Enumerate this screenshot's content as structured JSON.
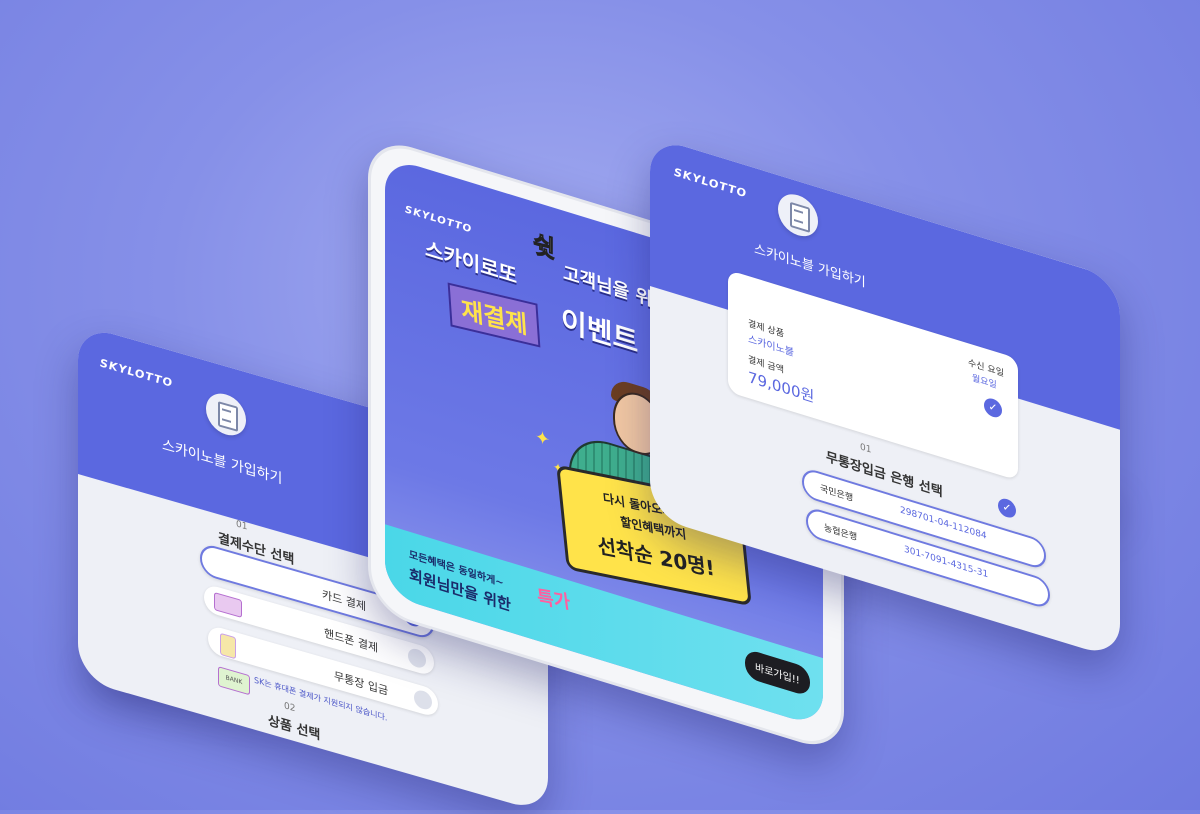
{
  "brand": {
    "logo_text": "SKYLOTTO",
    "logo_sub": "SKYLOTTO"
  },
  "left_phone": {
    "title": "스카이노블 가입하기",
    "step1_num": "01",
    "step1_label": "결제수단 선택",
    "options": [
      {
        "label": "카드 결제",
        "selected": true,
        "icon": "card-icon"
      },
      {
        "label": "핸드폰 결제",
        "selected": false,
        "icon": "phone-icon"
      },
      {
        "label": "무통장 입금",
        "selected": false,
        "icon": "bank-icon"
      }
    ],
    "bank_icon_text": "BANK",
    "notice": "SK는 휴대폰 결제가 지원되지 않습니다.",
    "step2_num": "02",
    "step2_label": "상품 선택"
  },
  "center_phone": {
    "headline_1": "스카이로또",
    "headline_accent": "쉿",
    "headline_2": "고객님을 위한",
    "tag": "재결제",
    "event": "이벤트",
    "sign_line1": "다시 돌아오지 않을",
    "sign_line2": "할인혜택까지",
    "sign_line3": "선착순 20명!",
    "ad_line1": "모든혜택은 동일하게~",
    "ad_line2": "회원님만을 위한",
    "ad_accent": "특가",
    "join_button": "바로가입!!"
  },
  "right_phone": {
    "title": "스카이노블 가입하기",
    "cycle_label": "수신 요일",
    "cycle_value": "월요일",
    "product_label": "결제 상품",
    "product_value": "스카이노블",
    "amount_label": "결제 금액",
    "amount_value": "79,000원",
    "step_num": "01",
    "step_label": "무통장입금 은행 선택",
    "banks": [
      {
        "name": "국민은행",
        "account": "298701-04-112084"
      },
      {
        "name": "농협은행",
        "account": "301-7091-4315-31"
      }
    ]
  },
  "colors": {
    "accent": "#5b68e0",
    "background": "#8690e8",
    "sign": "#ffe34a",
    "ad": "#4ad7e8"
  }
}
